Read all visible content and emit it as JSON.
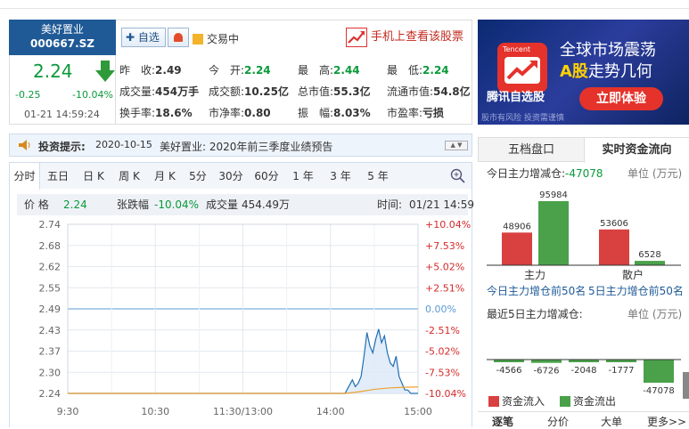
{
  "stock": {
    "name": "美好置业",
    "code": "000667.SZ",
    "price": "2.24",
    "change": "-0.25",
    "change_pct": "-10.04%",
    "time": "01-21 14:59:24"
  },
  "actions": {
    "watchlist_label": "自选",
    "status_label": "交易中",
    "mobile_link": "手机上查看该股票"
  },
  "quote": [
    {
      "label": "昨　收:",
      "value": "2.49",
      "color": "default"
    },
    {
      "label": "今　开:",
      "value": "2.24",
      "color": "green"
    },
    {
      "label": "最　高:",
      "value": "2.44",
      "color": "green"
    },
    {
      "label": "最　低:",
      "value": "2.24",
      "color": "green"
    },
    {
      "label": "成交量:",
      "value": "454万手",
      "color": "default"
    },
    {
      "label": "成交额:",
      "value": "10.25亿",
      "color": "default"
    },
    {
      "label": "总市值:",
      "value": "55.3亿",
      "color": "default"
    },
    {
      "label": "流通市值:",
      "value": "54.8亿",
      "color": "default"
    },
    {
      "label": "换手率:",
      "value": "18.6%",
      "color": "default"
    },
    {
      "label": "市净率:",
      "value": "0.80",
      "color": "default"
    },
    {
      "label": "振　幅:",
      "value": "8.03%",
      "color": "default"
    },
    {
      "label": "市盈率:",
      "value": "亏损",
      "color": "default"
    }
  ],
  "ad": {
    "brand_small": "Tencent",
    "line1": "全球市场震荡",
    "line2_highlight": "A股",
    "line2_rest": "走势几何",
    "app_name": "腾讯自选股",
    "cta": "立即体验",
    "disclaimer": "股市有风险 投资需谨慎"
  },
  "notice": {
    "label": "投资提示:",
    "date": "2020-10-15",
    "text": "美好置业: 2020年前三季度业绩预告",
    "nav": "▲ ▼"
  },
  "period_tabs": [
    "分时",
    "五日",
    "日 K",
    "周 K",
    "月 K",
    "5分",
    "30分",
    "60分",
    "1 年",
    "3 年",
    "5 年"
  ],
  "info": {
    "price_label": "价 格",
    "price": "2.24",
    "pct_label": "张跌幅",
    "pct": "-10.04%",
    "vol_label": "成交量",
    "vol": "454.49万",
    "time_label": "时间:",
    "time": "01/21 14:59"
  },
  "chart_data": {
    "type": "line",
    "title": "",
    "xlabel": "",
    "ylabel": "",
    "x_ticks": [
      "9:30",
      "10:30",
      "11:30/13:00",
      "14:00",
      "15:00"
    ],
    "y_ticks_left": [
      "2.74",
      "2.68",
      "2.62",
      "2.55",
      "2.49",
      "2.43",
      "2.37",
      "2.30",
      "2.24"
    ],
    "y_ticks_right": [
      "+10.04%",
      "+7.53%",
      "+5.02%",
      "+2.51%",
      "0.00%",
      "-2.51%",
      "-5.02%",
      "-7.53%",
      "-10.04%"
    ],
    "ylim": [
      2.24,
      2.74
    ],
    "prev_close": 2.49,
    "x_minutes_range": [
      0,
      240
    ],
    "series": [
      {
        "x": [
          0,
          20,
          40,
          60,
          80,
          100,
          120,
          140,
          160,
          180,
          190,
          195,
          197,
          199,
          201,
          203,
          205,
          207,
          209,
          211,
          213,
          215,
          217,
          219,
          221,
          223,
          225,
          227,
          229,
          231,
          233,
          235,
          237,
          240
        ],
        "values": [
          2.24,
          2.24,
          2.24,
          2.24,
          2.24,
          2.24,
          2.24,
          2.24,
          2.24,
          2.24,
          2.24,
          2.28,
          2.26,
          2.27,
          2.29,
          2.35,
          2.42,
          2.38,
          2.36,
          2.4,
          2.43,
          2.39,
          2.41,
          2.36,
          2.33,
          2.32,
          2.35,
          2.29,
          2.27,
          2.25,
          2.25,
          2.24,
          2.24,
          2.24
        ],
        "color": "#1f6fb5"
      },
      {
        "x": [
          0,
          190,
          200,
          210,
          220,
          230,
          240
        ],
        "values": [
          2.24,
          2.24,
          2.245,
          2.252,
          2.256,
          2.258,
          2.259
        ],
        "color": "#f0a030"
      }
    ]
  },
  "right_panel": {
    "tabs": [
      "五档盘口",
      "实时资金流向"
    ],
    "today_label": "今日主力增减仓:",
    "today_value": "-47078",
    "unit": "单位 (万元)",
    "bars_top": [
      {
        "value": 48906,
        "color": "#d94040"
      },
      {
        "value": 95984,
        "color": "#4aa14a"
      },
      {
        "value": 53606,
        "color": "#d94040"
      },
      {
        "value": 6528,
        "color": "#4aa14a"
      }
    ],
    "bar_top_labels": [
      "48906",
      "95984",
      "53606",
      "6528"
    ],
    "groups": [
      "主力",
      "散户"
    ],
    "link1": "今日主力增仓前50名",
    "link2": "5日主力增仓前50名",
    "five_day_label": "最近5日主力增减仓:",
    "five_day": [
      -4566,
      -6726,
      -2048,
      -1777,
      -47078
    ],
    "five_day_labels": [
      "-4566",
      "-6726",
      "-2048",
      "-1777",
      "-47078"
    ],
    "legend_in": "资金流入",
    "legend_out": "资金流出",
    "bottom_tabs": [
      "逐笔",
      "分价",
      "大单",
      "更多>>"
    ]
  }
}
